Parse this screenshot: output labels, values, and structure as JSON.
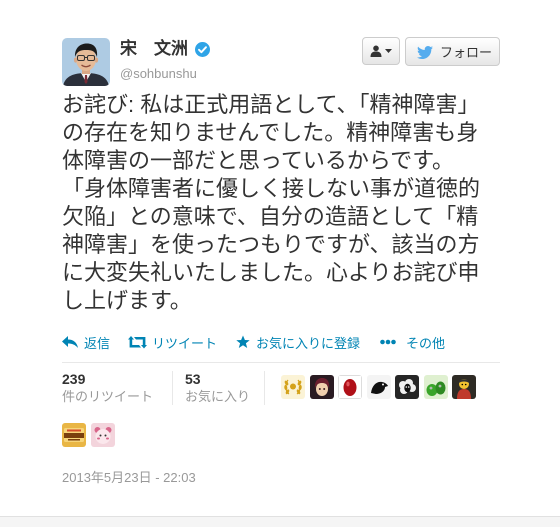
{
  "user": {
    "name": "宋　文洲",
    "handle": "@sohbunshu",
    "verified": true
  },
  "header_buttons": {
    "follow_label": "フォロー"
  },
  "tweet": {
    "lines": [
      "お詫び: 私は正式用語として、「精神障害」",
      "の存在を知りませんでした。精神障害も身",
      "体障害の一部だと思っているからです。",
      "「身体障害者に優しく接しない事が道徳的",
      "欠陥」との意味で、自分の造語として「精",
      "神障害」を使ったつもりですが、該当の方",
      "に大変失礼いたしました。心よりお詫び申",
      "し上げます。"
    ]
  },
  "actions": {
    "reply": "返信",
    "retweet": "リツイート",
    "favorite": "お気に入りに登録",
    "more": "その他"
  },
  "stats": {
    "retweets": {
      "count": "239",
      "label": "件のリツイート"
    },
    "favorites": {
      "count": "53",
      "label": "お気に入り"
    }
  },
  "engaged_users": [
    {
      "icon": "laurel-avatar",
      "bg": "#fbf3d6",
      "fg": "#d4a21a"
    },
    {
      "icon": "anime-character-avatar",
      "bg": "#2a1b22",
      "fg": "#f1cfae"
    },
    {
      "icon": "red-egg-avatar",
      "bg": "#ffffff",
      "fg": "#b01018"
    },
    {
      "icon": "black-bird-avatar",
      "bg": "#f4f4f4",
      "fg": "#111111"
    },
    {
      "icon": "black-sheep-avatar",
      "bg": "#262626",
      "fg": "#f0f0f0"
    },
    {
      "icon": "green-monster-avatar",
      "bg": "#dff0d0",
      "fg": "#3aa52a"
    },
    {
      "icon": "cartoon-person-avatar",
      "bg": "#2e2b25",
      "fg": "#f2c230"
    },
    {
      "icon": "pudding-box-avatar",
      "bg": "#e9b645",
      "fg": "#7a3f0e"
    },
    {
      "icon": "pink-character-avatar",
      "bg": "#f3d4dc",
      "fg": "#d8668a"
    }
  ],
  "timestamp": "2013年5月23日 - 22:03",
  "colors": {
    "link": "#0084b4",
    "text": "#333333",
    "muted": "#999999",
    "verified": "#2fa4e7",
    "twitter_bird": "#55acee"
  },
  "icons": {
    "reply": "reply-icon",
    "retweet": "retweet-icon",
    "favorite": "star-icon",
    "more": "more-dots-icon",
    "user_menu": "person-icon",
    "follow": "twitter-bird-icon",
    "verified": "verified-badge-icon"
  }
}
